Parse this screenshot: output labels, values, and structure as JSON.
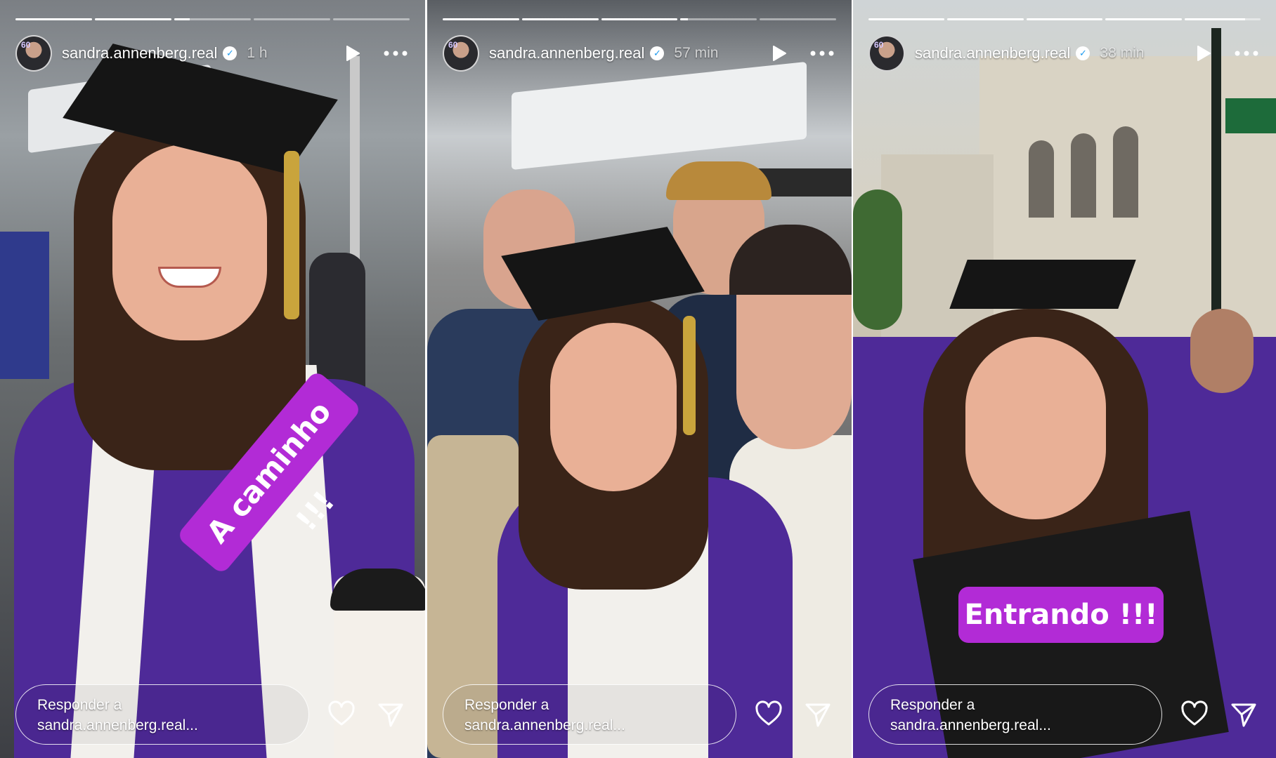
{
  "stories": [
    {
      "username": "sandra.annenberg.real",
      "time": "1 h",
      "progress": [
        1,
        1,
        0.2,
        0,
        0
      ],
      "sticker": "A caminho !!!",
      "reply_placeholder_line1": "Responder a",
      "reply_placeholder_line2": "sandra.annenberg.real..."
    },
    {
      "username": "sandra.annenberg.real",
      "time": "57 min",
      "progress": [
        1,
        1,
        1,
        0.1,
        0
      ],
      "sticker": "",
      "reply_placeholder_line1": "Responder a",
      "reply_placeholder_line2": "sandra.annenberg.real..."
    },
    {
      "username": "sandra.annenberg.real",
      "time": "38 min",
      "progress": [
        1,
        1,
        1,
        1,
        0.8
      ],
      "sticker": "Entrando !!!",
      "reply_placeholder_line1": "Responder a",
      "reply_placeholder_line2": "sandra.annenberg.real..."
    }
  ],
  "icons": {
    "play": "play-icon",
    "more": "more-icon",
    "heart": "heart-icon",
    "send": "send-icon",
    "verified": "verified-badge-icon"
  },
  "colors": {
    "sticker": "#b22bd6",
    "text": "#ffffff",
    "verified": "#1d9bf0"
  }
}
